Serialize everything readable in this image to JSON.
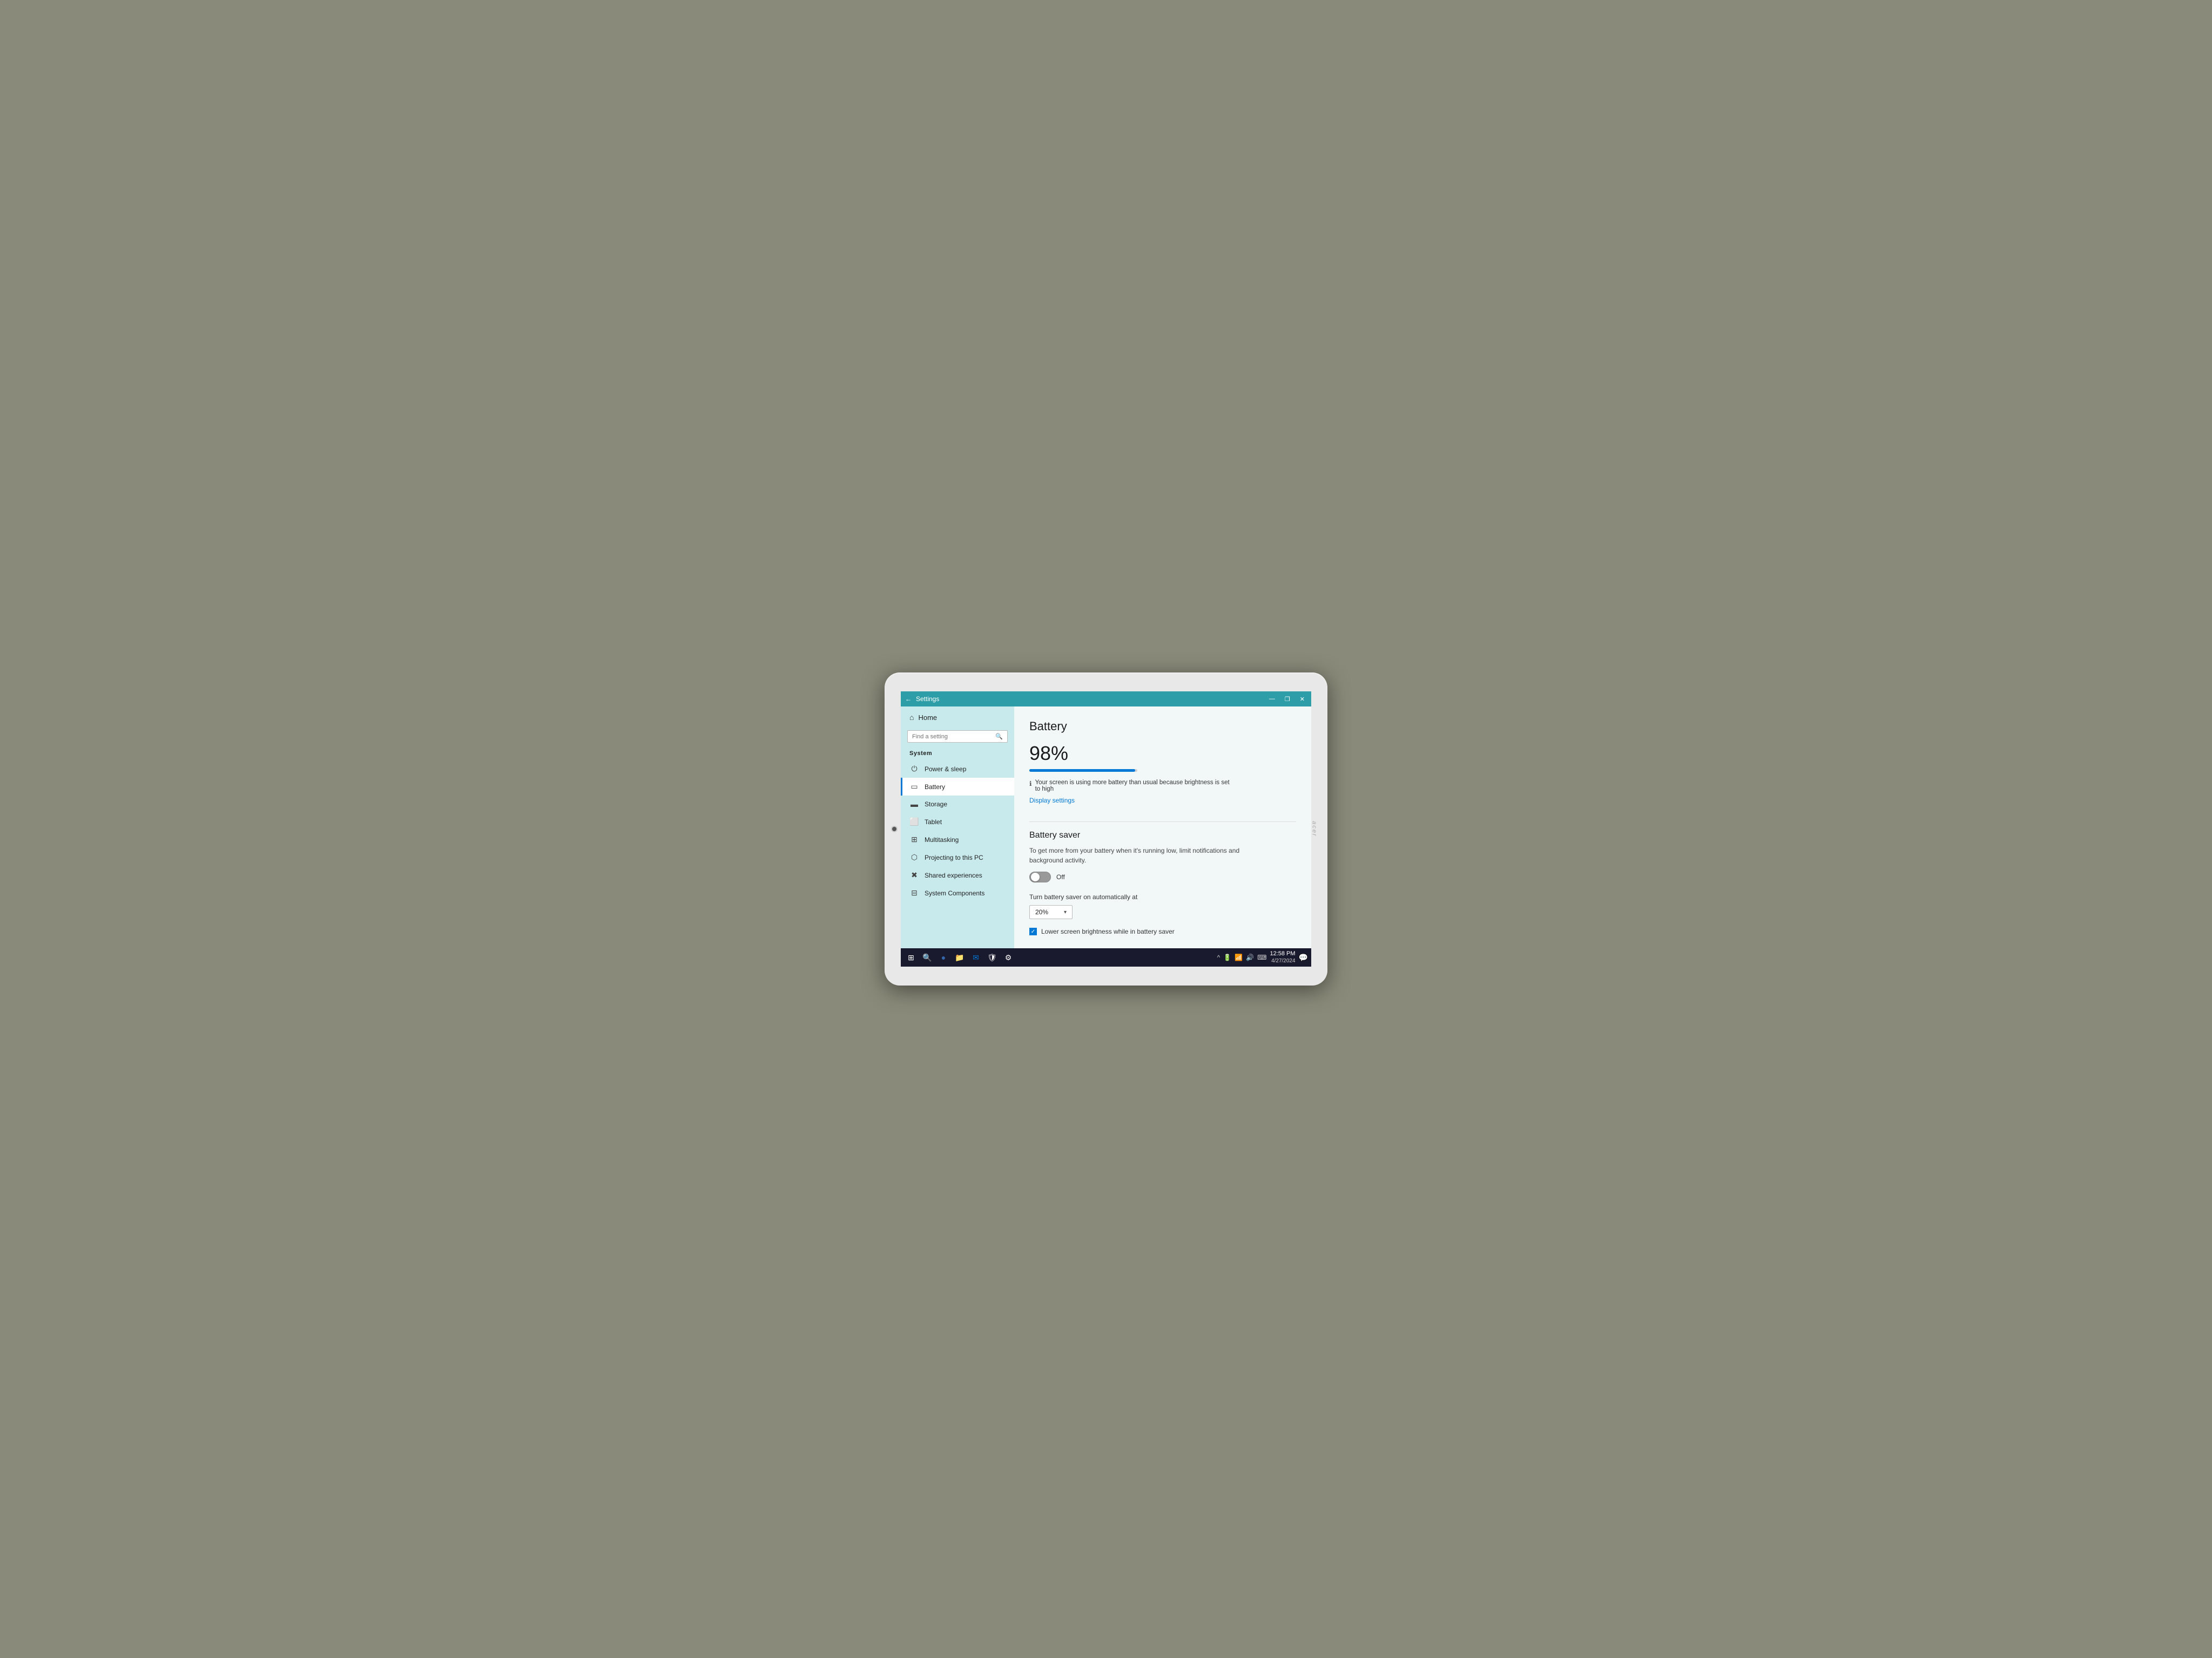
{
  "tablet": {
    "brand": "acer"
  },
  "titlebar": {
    "back_label": "←",
    "title": "Settings",
    "minimize": "—",
    "restore": "❐",
    "close": "✕"
  },
  "sidebar": {
    "home_label": "Home",
    "search_placeholder": "Find a setting",
    "section_label": "System",
    "items": [
      {
        "id": "power-sleep",
        "icon": "⏻",
        "label": "Power & sleep"
      },
      {
        "id": "battery",
        "icon": "🔋",
        "label": "Battery",
        "active": true
      },
      {
        "id": "storage",
        "icon": "▬",
        "label": "Storage"
      },
      {
        "id": "tablet",
        "icon": "⬜",
        "label": "Tablet"
      },
      {
        "id": "multitasking",
        "icon": "⊞",
        "label": "Multitasking"
      },
      {
        "id": "projecting",
        "icon": "⬡",
        "label": "Projecting to this PC"
      },
      {
        "id": "shared-exp",
        "icon": "✖",
        "label": "Shared experiences"
      },
      {
        "id": "system-components",
        "icon": "⊟",
        "label": "System Components"
      }
    ]
  },
  "content": {
    "page_title": "Battery",
    "battery_percent": "98%",
    "battery_fill_width": "98%",
    "warning_text": "Your screen is using more battery than usual because brightness is set to high",
    "display_settings_link": "Display settings",
    "battery_saver_title": "Battery saver",
    "battery_saver_desc": "To get more from your battery when it's running low, limit notifications and background activity.",
    "toggle_state": "Off",
    "auto_saver_label": "Turn battery saver on automatically at",
    "dropdown_value": "20%",
    "checkbox_label": "Lower screen brightness while in battery saver"
  },
  "taskbar": {
    "icons": [
      {
        "id": "windows",
        "symbol": "⊞",
        "label": "Start"
      },
      {
        "id": "search",
        "symbol": "🔍",
        "label": "Search"
      },
      {
        "id": "edge",
        "symbol": "⬤",
        "label": "Microsoft Edge"
      },
      {
        "id": "files",
        "symbol": "📁",
        "label": "File Explorer"
      },
      {
        "id": "mail",
        "symbol": "✉",
        "label": "Mail"
      },
      {
        "id": "defender",
        "symbol": "🛡",
        "label": "Windows Defender"
      },
      {
        "id": "settings",
        "symbol": "⚙",
        "label": "Settings"
      }
    ],
    "sys_icons": [
      "^",
      "🔋",
      "📶",
      "🔊",
      "⌨"
    ],
    "time": "12:58 PM",
    "date": "4/27/2024",
    "notif_icon": "💬"
  }
}
